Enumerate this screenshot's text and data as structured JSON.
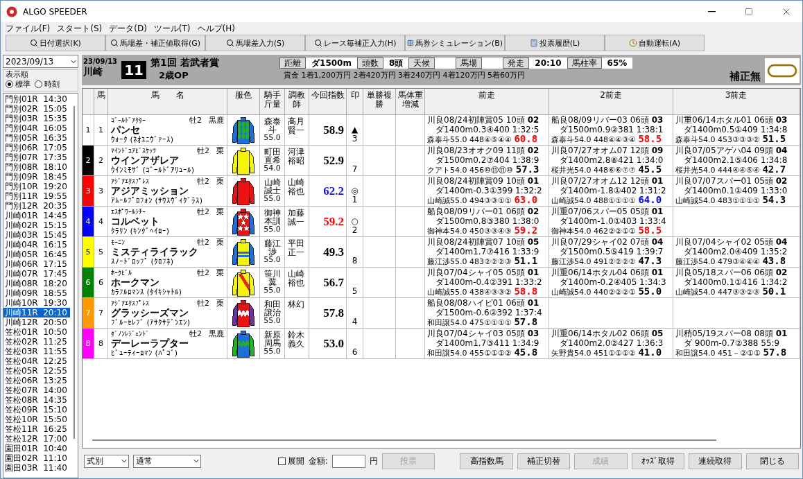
{
  "window": {
    "title": "ALGO SPEEDER"
  },
  "menu": [
    "ファイル(F)",
    "スタート(S)",
    "データ(D)",
    "ツール(T)",
    "ヘルプ(H)"
  ],
  "toolbar": [
    {
      "label": "日付選択(K)",
      "kind": "search"
    },
    {
      "label": "馬場差・補正値取得(G)",
      "kind": "search"
    },
    {
      "label": "馬場差入力(S)",
      "kind": "search"
    },
    {
      "label": "レース毎補正入力(H)",
      "kind": "search"
    },
    {
      "label": "馬券シミュレーション(B)",
      "kind": "table"
    },
    {
      "label": "投票履歴(L)",
      "kind": "calculator"
    },
    {
      "label": "自動運転(A)",
      "kind": "clock"
    }
  ],
  "sidebar": {
    "date": "2023/09/13",
    "sort_group": "表示順",
    "sort_options": [
      {
        "label": "標準",
        "selected": true
      },
      {
        "label": "時刻",
        "selected": false
      }
    ],
    "races": [
      {
        "label": "門別01R  14:30",
        "selected": false
      },
      {
        "label": "門別02R  15:05",
        "selected": false
      },
      {
        "label": "門別03R  15:35",
        "selected": false
      },
      {
        "label": "門別04R  16:05",
        "selected": false
      },
      {
        "label": "門別05R  16:35",
        "selected": false
      },
      {
        "label": "門別06R  17:05",
        "selected": false
      },
      {
        "label": "門別07R  17:35",
        "selected": false
      },
      {
        "label": "門別08R  18:10",
        "selected": false
      },
      {
        "label": "門別09R  18:45",
        "selected": false
      },
      {
        "label": "門別10R  19:20",
        "selected": false
      },
      {
        "label": "門別11R  19:55",
        "selected": false
      },
      {
        "label": "門別12R  20:35",
        "selected": false
      },
      {
        "label": "川崎01R  14:45",
        "selected": false
      },
      {
        "label": "川崎02R  15:15",
        "selected": false
      },
      {
        "label": "川崎03R  15:45",
        "selected": false
      },
      {
        "label": "川崎04R  16:15",
        "selected": false
      },
      {
        "label": "川崎05R  16:45",
        "selected": false
      },
      {
        "label": "川崎06R  17:15",
        "selected": false
      },
      {
        "label": "川崎07R  17:45",
        "selected": false
      },
      {
        "label": "川崎08R  18:20",
        "selected": false
      },
      {
        "label": "川崎09R  18:55",
        "selected": false
      },
      {
        "label": "川崎10R  19:30",
        "selected": false
      },
      {
        "label": "川崎11R  20:10",
        "selected": true
      },
      {
        "label": "川崎12R  20:50",
        "selected": false
      },
      {
        "label": "笠松01R  10:50",
        "selected": false
      },
      {
        "label": "笠松02R  11:25",
        "selected": false
      },
      {
        "label": "笠松03R  11:55",
        "selected": false
      },
      {
        "label": "笠松04R  12:25",
        "selected": false
      },
      {
        "label": "笠松05R  12:55",
        "selected": false
      },
      {
        "label": "笠松06R  13:25",
        "selected": false
      },
      {
        "label": "笠松07R  14:00",
        "selected": false
      },
      {
        "label": "笠松08R  14:35",
        "selected": false
      },
      {
        "label": "笠松09R  15:10",
        "selected": false
      },
      {
        "label": "笠松10R  15:50",
        "selected": false
      },
      {
        "label": "笠松11R  16:25",
        "selected": false
      },
      {
        "label": "笠松12R  17:00",
        "selected": false
      },
      {
        "label": "園田01R  10:40",
        "selected": false
      },
      {
        "label": "園田02R  11:10",
        "selected": false
      },
      {
        "label": "園田03R  11:40",
        "selected": false
      }
    ]
  },
  "race": {
    "date": "23/09/13",
    "venue": "川崎",
    "number": "11",
    "title": "第1回 若武者賞",
    "class": "2歳OP",
    "info": [
      {
        "label": "距離",
        "value": "ダ1500m"
      },
      {
        "label": "頭数",
        "value": "8頭"
      },
      {
        "label": "天候"
      },
      {
        "label": "馬場"
      },
      {
        "label": "発走",
        "value": "20:10"
      },
      {
        "label": "馬柱率",
        "value": "65%"
      }
    ],
    "prize": "賞金 1着1,200万円 2着420万円 3着240万円 4着120万円 5着60万円",
    "correction": "補正無"
  },
  "table": {
    "columns": [
      "馬",
      "馬　　名",
      "服色",
      "騎手斤量",
      "調教師",
      "今回指数",
      "印",
      "単勝複勝",
      "馬体重増減",
      "前走",
      "2前走",
      "3前走"
    ],
    "rows": [
      {
        "frame": {
          "label": "1",
          "color": "#ffffff"
        },
        "number": "1",
        "sire": "ｺﾞｰﾙﾄﾞｱｸﾀｰ",
        "sex": "牡2",
        "coat": "黒鹿",
        "name": "パンセ",
        "dam": "ｳｫｰｸ (ﾈｵﾕﾆｳﾞｧｰｽ)",
        "silks": {
          "kind": "diamonds",
          "color": "#1e6fd9",
          "sleeves": {
            "color": "#1e6fd9"
          },
          "pattern": {
            "color": "#22b322"
          }
        },
        "jockey": "森泰斗",
        "weight": "55.0",
        "trainer": "高月賢一",
        "index": {
          "value": "58.9",
          "color": "#000000"
        },
        "mark": "▲",
        "rank": "3",
        "past": [
          {
            "head": "川良08/24初陣賞05 10頭 **02**",
            "detail": "ダ1400m0.3④400 1:32:5",
            "result": "森泰斗55.0 448④⑤④④",
            "score": "60.8",
            "color": "#ff0000"
          },
          {
            "head": "船良08/09リバー03 06頭 **03**",
            "detail": "ダ1500m0.9②381 1:38:1",
            "result": "森泰斗54.0 448④④③④",
            "score": "58.5",
            "color": "#ff0000"
          },
          {
            "head": "川重06/14ホタル01 06頭 **03**",
            "detail": "ダ1400m0.5①409 1:34:8",
            "result": "森泰斗54.0 453③③③②",
            "score": "51.5",
            "color": "#000000"
          }
        ]
      },
      {
        "frame": {
          "label": "2",
          "color": "#000000"
        },
        "number": "2",
        "sire": "ﾏｲﾝﾄﾞﾕｱﾋﾞｽｹｯﾂ",
        "sex": "牡2",
        "coat": "栗",
        "name": "ウインアザレア",
        "dam": "ｳｲﾝﾐﾓｻﾞ (ｺﾞｰﾙﾄﾞｱﾘｭｰﾙ)",
        "silks": {
          "kind": "plain",
          "color": "#f5f500",
          "sleeves": {
            "color": "#f5f500"
          }
        },
        "jockey": "町田直希",
        "weight": "54.0",
        "trainer": "河津裕昭",
        "index": {
          "value": "52.9",
          "color": "#000000"
        },
        "rank": "7",
        "past": [
          {
            "head": "川良08/23オオク09 11頭 **02**",
            "detail": "ダ1500m0.2⑦404 1:38:9",
            "result": "クアト54.0 456⑩⑪⑪⑩",
            "score": "57.3",
            "color": "#000000"
          },
          {
            "head": "川良07/27オオム07 12頭 **09**",
            "detail": "ダ1400m2.8⑧421 1:34:0",
            "result": "桜井光54.0 448⑥⑥⑦⑦",
            "score": "45.5",
            "color": "#000000"
          },
          {
            "head": "川良07/05アゲハ04 09頭 **04**",
            "detail": "ダ1400m2.1⑤406 1:34:8",
            "result": "桜井光54.0 444④④⑤④",
            "score": "42.7",
            "color": "#000000"
          }
        ]
      },
      {
        "frame": {
          "label": "3",
          "color": "#ff0000"
        },
        "number": "3",
        "sire": "ｱｼﾞｱｴｸｽﾌﾟﾚｽ",
        "sex": "牡2",
        "coat": "栗",
        "name": "アジアミッション",
        "dam": "ｱﾑｰﾙﾌﾟﾛﾌｫﾝ (ｻｳｽｳﾞｨｸﾞﾗｽ)",
        "silks": {
          "kind": "plain",
          "color": "#ee1111",
          "sleeves": {
            "color": "#ee1111"
          }
        },
        "jockey": "山崎誠士",
        "weight": "55.0",
        "trainer": "山崎裕也",
        "index": {
          "value": "62.2",
          "color": "#1010ee"
        },
        "mark": "◎",
        "rank": "1",
        "past": [
          {
            "head": "川良08/24初陣賞09 10頭 **01**",
            "detail": "ダ1400m-0.3①399 1:32:2",
            "result": "山崎誠55.0 494③③①①",
            "score": "63.0",
            "color": "#ff0000"
          },
          {
            "head": "川良07/27オオム12 12頭 **01**",
            "detail": "ダ1400m-1.8①402 1:31:2",
            "result": "山崎誠54.0 488①①①①",
            "score": "64.0",
            "color": "#0000ff"
          },
          {
            "head": "川良07/07スパー01 05頭 **02**",
            "detail": "ダ1400m0.1①409 1:33:0",
            "result": "山崎誠54.0 483①①①①",
            "score": "54.3",
            "color": "#000000"
          }
        ]
      },
      {
        "frame": {
          "label": "4",
          "color": "#0000ff"
        },
        "number": "4",
        "sire": "ｴｽﾎﾟﾜｰﾙｼﾁｰ",
        "sex": "牡2",
        "coat": "栗",
        "name": "コルベット",
        "dam": "ｸﾗﾘﾝ (ｷﾝｸﾞﾍｲﾛｰ)",
        "silks": {
          "kind": "stars",
          "color": "#ee1111",
          "sleeves": {
            "color": "#1e6fd9"
          },
          "pattern": {
            "color": "#ffffff"
          }
        },
        "jockey": "御神本訓",
        "weight": "55.0",
        "trainer": "加藤誠一",
        "index": {
          "value": "59.2",
          "color": "#ff0000"
        },
        "mark": "○",
        "rank": "2",
        "past": [
          {
            "head": "船良08/09リバー01 06頭 **02**",
            "detail": "ダ1500m0.8③380 1:38:0",
            "result": "御神本54.0 450③③④③",
            "score": "59.2",
            "color": "#ff0000"
          },
          {
            "head": "川重07/06スパー05 05頭 **01**",
            "detail": "ダ1400m-1.0①403 1:33:4",
            "result": "御神本54.0 462②②①①",
            "score": "58.5",
            "color": "#ff0000"
          }
        ]
      },
      {
        "frame": {
          "label": "5",
          "color": "#ffff00"
        },
        "number": "5",
        "sire": "ﾓｰﾆﾝ",
        "sex": "牡2",
        "coat": "栗",
        "name": "ミスティライラック",
        "dam": "ｽﾉｰﾄﾞﾛｯﾌﾟ (ｸﾛﾌﾈ)",
        "silks": {
          "kind": "hoops",
          "color": "#f5f500",
          "sleeves": {
            "color": "#1e6fd9"
          },
          "pattern": {
            "color": "#1e6fd9"
          }
        },
        "jockey": "藤江渉",
        "weight": "55.0",
        "trainer": "平田正一",
        "index": {
          "value": "49.3",
          "color": "#000000"
        },
        "rank": "8",
        "past": [
          {
            "head": "川良08/24初陣賞07 10頭 **05**",
            "detail": "ダ1400m1.7⑦416 1:33:9",
            "result": "藤江渉55.0 483②②②③",
            "score": "51.1",
            "color": "#000000"
          },
          {
            "head": "川良07/29シャイ02 07頭 **04**",
            "detail": "ダ1500m0.5⑤419 1:39:7",
            "result": "藤江渉54.0 491②②②②",
            "score": "47.3",
            "color": "#000000"
          },
          {
            "head": "川良07/04シャイ02 05頭 **04**",
            "detail": "ダ1400m2.0④409 1:35:2",
            "result": "藤江渉54.0 479③④④④",
            "score": "43.8",
            "color": "#000000"
          }
        ]
      },
      {
        "frame": {
          "label": "6",
          "color": "#008000"
        },
        "number": "6",
        "sire": "ﾎｰｸﾋﾞﾙ",
        "sex": "牡2",
        "coat": "栗",
        "name": "ホークマン",
        "dam": "ｶﾗﾌﾙﾛﾏﾝｽ (ﾀｲｷｼｬﾄﾙ)",
        "silks": {
          "kind": "sash",
          "color": "#f5f500",
          "sleeves": {
            "color": "#f5f500"
          },
          "pattern": {
            "color": "#ee2222"
          }
        },
        "jockey": "笹川翼",
        "weight": "55.0",
        "trainer": "山崎裕也",
        "index": {
          "value": "56.7",
          "color": "#000000"
        },
        "rank": "5",
        "past": [
          {
            "head": "川良07/04シャイ05 05頭 **01**",
            "detail": "ダ1400m-0.4②391 1:33:2",
            "result": "山崎誠55.0 438④③③②",
            "score": "58.8",
            "color": "#ff0000"
          },
          {
            "head": "川重06/14ホタル04 06頭 **01**",
            "detail": "ダ1400m-0.2④405 1:34:3",
            "result": "山崎誠54.0 440②②②①",
            "score": "55.0",
            "color": "#000000"
          },
          {
            "head": "川良05/18スパー06 06頭 **02**",
            "detail": "ダ1400m0.1①416 1:34:2",
            "result": "山崎誠54.0 447③③②③",
            "score": "50.1",
            "color": "#000000"
          }
        ]
      },
      {
        "frame": {
          "label": "7",
          "color": "#ff9900"
        },
        "number": "7",
        "sire": "ｱｼﾞｱｴｸｽﾌﾟﾚｽ",
        "sex": "牡2",
        "coat": "栗",
        "name": "グラッシーズマン",
        "dam": "ﾌﾞﾙｰｾﾚﾌﾞ (ｱｻｸｻﾃﾞﾝｴﾝ)",
        "silks": {
          "kind": "zigzag",
          "color": "#ee1111",
          "sleeves": {
            "color": "#7030a0"
          },
          "pattern": {
            "color": "#ffffff"
          }
        },
        "jockey": "和田譲治",
        "weight": "55.0",
        "trainer": "林幻",
        "index": {
          "value": "57.8",
          "color": "#000000"
        },
        "rank": "4",
        "past": [
          {
            "head": "船良08/08ハイビ01 06頭 **01**",
            "detail": "ダ1500m-0.6②392 1:37:4",
            "result": "和田譲54.0 475①①①①",
            "score": "57.8",
            "color": "#000000"
          }
        ]
      },
      {
        "frame": {
          "label": "8",
          "color": "#ff00ff"
        },
        "number": "8",
        "sire": "ﾀﾞﾉﾝﾚｼﾞｪﾝﾄﾞ",
        "sex": "牡2",
        "coat": "黒鹿",
        "name": "デーレーラプター",
        "dam": "ﾋﾞｭｰﾃｨｰﾛﾏﾝ (ﾊﾟｺﾞ)",
        "silks": {
          "kind": "zigzag",
          "color": "#1e6fd9",
          "sleeves": {
            "color": "#22b322"
          },
          "pattern": {
            "color": "#22b322"
          }
        },
        "jockey": "新原周馬",
        "weight": "55.0",
        "trainer": "鈴木義久",
        "index": {
          "value": "53.0",
          "color": "#000000"
        },
        "rank": "6",
        "past": [
          {
            "head": "川良07/04シャイ03 05頭 **03**",
            "detail": "ダ1400m1.7③411 1:34:9",
            "result": "和田譲54.0 455①①①②",
            "score": "45.8",
            "color": "#000000"
          },
          {
            "head": "川重06/14ホタル02 06頭 **05**",
            "detail": "ダ1400m2.0②427 1:36:3",
            "result": "矢野貴54.0 451①①①②",
            "score": "41.0",
            "color": "#000000"
          },
          {
            "head": "川稍05/19スパー08 08頭 **01**",
            "detail": "ダ 900m-0.7②388 55:9",
            "result": "和田譲54.0 451－②①①",
            "score": "57.8",
            "color": "#000000"
          }
        ]
      }
    ]
  },
  "footer": {
    "bet_type": "式別",
    "mode": "通常",
    "expand": {
      "label": "展開",
      "checked": false
    },
    "amount_label": "金額:",
    "unit": "円",
    "buttons": [
      {
        "label": "投票",
        "disabled": true
      },
      {
        "label": "高指数馬",
        "disabled": false
      },
      {
        "label": "補正切替",
        "disabled": false
      },
      {
        "label": "成績",
        "disabled": true
      },
      {
        "label": "ｵｯｽﾞ取得",
        "disabled": false
      },
      {
        "label": "連続取得",
        "disabled": false
      },
      {
        "label": "閉じる",
        "disabled": false
      }
    ]
  }
}
